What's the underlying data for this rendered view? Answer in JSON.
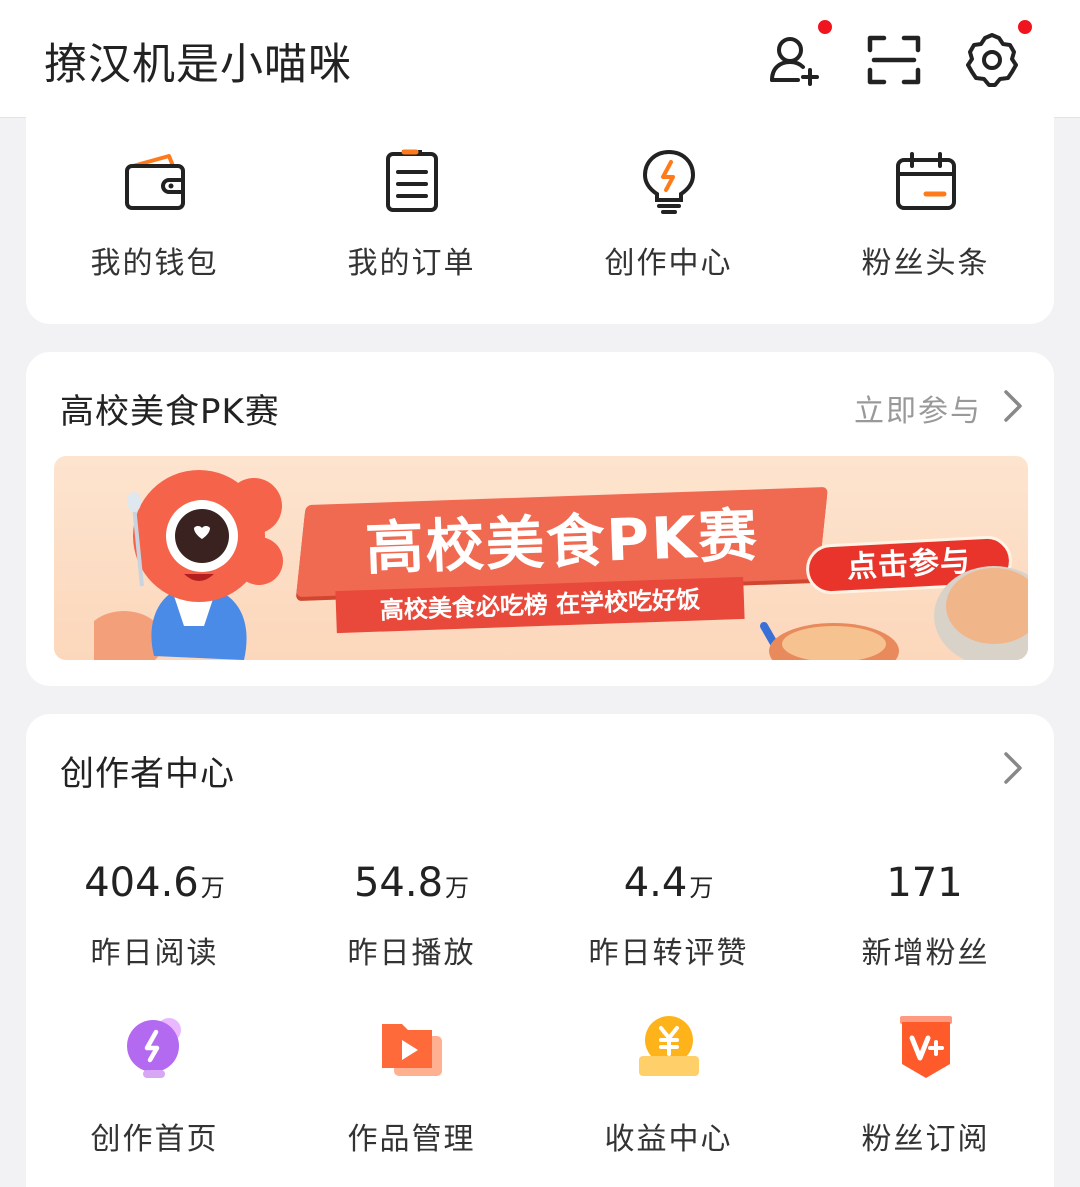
{
  "header": {
    "username": "撩汉机是小喵咪",
    "icons": [
      "add-friend-icon",
      "scan-icon",
      "settings-icon"
    ]
  },
  "quick_actions": [
    {
      "label": "我的钱包",
      "icon": "wallet-icon"
    },
    {
      "label": "我的订单",
      "icon": "order-icon"
    },
    {
      "label": "创作中心",
      "icon": "lightbulb-icon"
    },
    {
      "label": "粉丝头条",
      "icon": "calendar-icon"
    }
  ],
  "promo": {
    "title": "高校美食PK赛",
    "link_label": "立即参与",
    "banner": {
      "headline": "高校美食PK赛",
      "subline": "高校美食必吃榜 在学校吃好饭",
      "button": "点击参与"
    }
  },
  "creator": {
    "title": "创作者中心",
    "stats": [
      {
        "value": "404.6",
        "unit": "万",
        "label": "昨日阅读"
      },
      {
        "value": "54.8",
        "unit": "万",
        "label": "昨日播放"
      },
      {
        "value": "4.4",
        "unit": "万",
        "label": "昨日转评赞"
      },
      {
        "value": "171",
        "unit": "",
        "label": "新增粉丝"
      }
    ],
    "tools": [
      {
        "label": "创作首页",
        "icon": "bolt-bulb-icon"
      },
      {
        "label": "作品管理",
        "icon": "video-folder-icon"
      },
      {
        "label": "收益中心",
        "icon": "yuan-coin-icon"
      },
      {
        "label": "粉丝订阅",
        "icon": "v-plus-badge-icon"
      }
    ]
  },
  "colors": {
    "accent": "#ff7a1a",
    "red_dot": "#f0141e",
    "banner_red": "#e8493a"
  }
}
